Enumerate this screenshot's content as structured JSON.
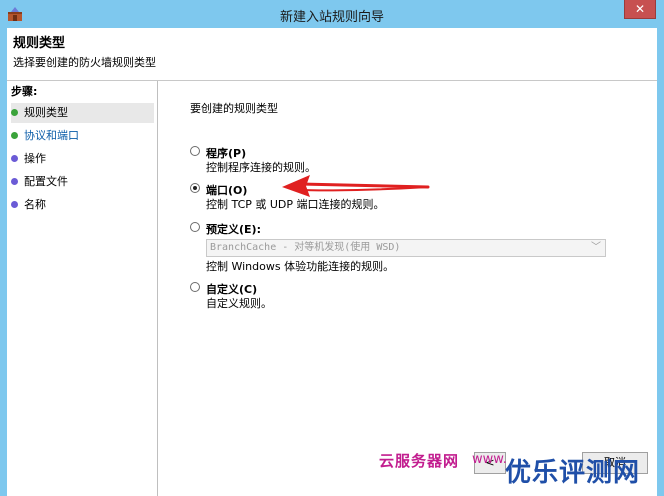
{
  "window": {
    "title": "新建入站规则向导",
    "close_label": "✕"
  },
  "header": {
    "title": "规则类型",
    "subtitle": "选择要创建的防火墙规则类型"
  },
  "sidebar": {
    "heading": "步骤:",
    "items": [
      {
        "label": "规则类型",
        "dot_color": "#3aa33a"
      },
      {
        "label": "协议和端口",
        "dot_color": "#3aa33a"
      },
      {
        "label": "操作",
        "dot_color": "#6b5bd6"
      },
      {
        "label": "配置文件",
        "dot_color": "#6b5bd6"
      },
      {
        "label": "名称",
        "dot_color": "#6b5bd6"
      }
    ]
  },
  "main": {
    "question": "要创建的规则类型",
    "options": [
      {
        "label": "程序(P)",
        "description": "控制程序连接的规则。",
        "checked": false
      },
      {
        "label": "端口(O)",
        "description": "控制 TCP 或 UDP 端口连接的规则。",
        "checked": true
      },
      {
        "label": "预定义(E):",
        "description": "控制 Windows 体验功能连接的规则。",
        "checked": false
      },
      {
        "label": "自定义(C)",
        "description": "自定义规则。",
        "checked": false
      }
    ],
    "predefined_select": {
      "value": "BranchCache - 对等机发现(使用 WSD)"
    }
  },
  "footer": {
    "back_label": "<",
    "cancel_label": "取消"
  },
  "watermarks": {
    "left": "云服务器网",
    "mid": "www.",
    "right": "优乐评测网"
  },
  "colors": {
    "titlebar": "#7ec8ee",
    "close": "#c75050",
    "arrow": "#e02020"
  }
}
